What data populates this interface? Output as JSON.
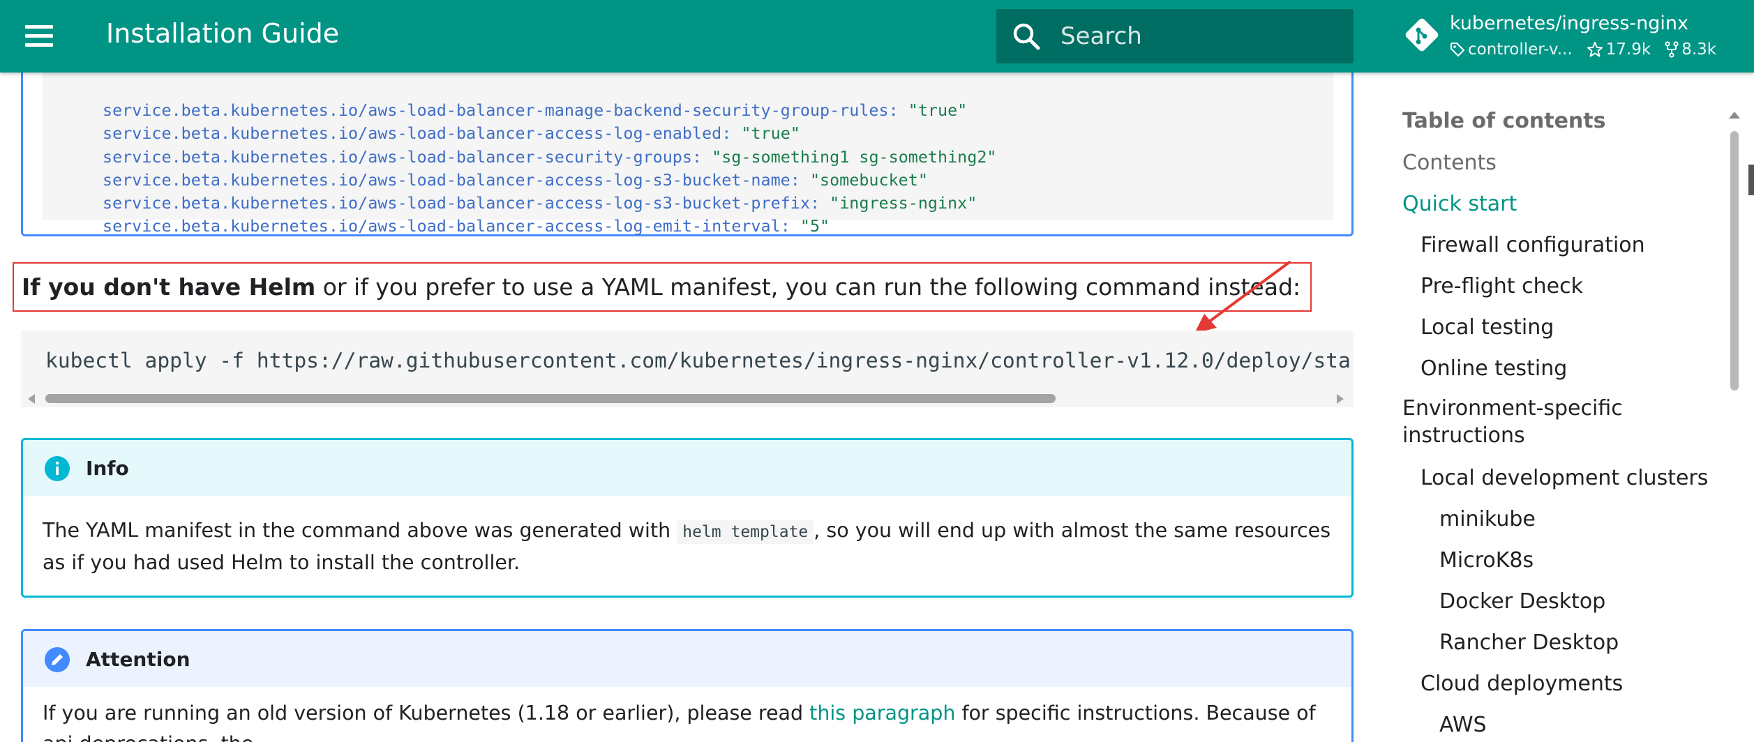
{
  "colors": {
    "header_bg": "#009485",
    "accent": "#009485",
    "info_border": "#00b8d4",
    "attention_border": "#448aff",
    "annotation_red": "#e53935"
  },
  "header": {
    "title": "Installation Guide",
    "menu_icon": "hamburger-menu-icon",
    "search_placeholder": "Search",
    "repo": {
      "name": "kubernetes/ingress-nginx",
      "version": "controller-v...",
      "stars": "17.9k",
      "forks": "8.3k"
    }
  },
  "top_code": {
    "lines": [
      {
        "key": "service.beta.kubernetes.io/aws-load-balancer-manage-backend-security-group-rules",
        "value": "\"true\""
      },
      {
        "key": "service.beta.kubernetes.io/aws-load-balancer-access-log-enabled",
        "value": "\"true\""
      },
      {
        "key": "service.beta.kubernetes.io/aws-load-balancer-security-groups",
        "value": "\"sg-something1 sg-something2\""
      },
      {
        "key": "service.beta.kubernetes.io/aws-load-balancer-access-log-s3-bucket-name",
        "value": "\"somebucket\""
      },
      {
        "key": "service.beta.kubernetes.io/aws-load-balancer-access-log-s3-bucket-prefix",
        "value": "\"ingress-nginx\""
      },
      {
        "key": "service.beta.kubernetes.io/aws-load-balancer-access-log-emit-interval",
        "value": "\"5\""
      }
    ]
  },
  "lead": {
    "bold": "If you don't have Helm",
    "rest": " or if you prefer to use a YAML manifest, you can run the following command instead:"
  },
  "command": "kubectl apply -f https://raw.githubusercontent.com/kubernetes/ingress-nginx/controller-v1.12.0/deploy/sta",
  "info": {
    "title": "Info",
    "text_before": "The YAML manifest in the command above was generated with ",
    "code": "helm template",
    "text_after": ", so you will end up with almost the same resources as if you had used Helm to install the controller."
  },
  "attention": {
    "title": "Attention",
    "text_before": "If you are running an old version of Kubernetes (1.18 or earlier), please read ",
    "link": "this paragraph",
    "text_after": " for specific instructions. Because of api deprecations, the"
  },
  "toc": {
    "heading": "Table of contents",
    "items": [
      {
        "label": "Contents",
        "level": 0,
        "active": false,
        "muted": true
      },
      {
        "label": "Quick start",
        "level": 0,
        "active": true
      },
      {
        "label": "Firewall configuration",
        "level": 1
      },
      {
        "label": "Pre-flight check",
        "level": 1
      },
      {
        "label": "Local testing",
        "level": 1
      },
      {
        "label": "Online testing",
        "level": 1
      },
      {
        "label": "Environment-specific",
        "label2": "instructions",
        "level": 0
      },
      {
        "label": "Local development clusters",
        "level": 1
      },
      {
        "label": "minikube",
        "level": 2
      },
      {
        "label": "MicroK8s",
        "level": 2
      },
      {
        "label": "Docker Desktop",
        "level": 2
      },
      {
        "label": "Rancher Desktop",
        "level": 2
      },
      {
        "label": "Cloud deployments",
        "level": 1
      },
      {
        "label": "AWS",
        "level": 2
      }
    ]
  }
}
